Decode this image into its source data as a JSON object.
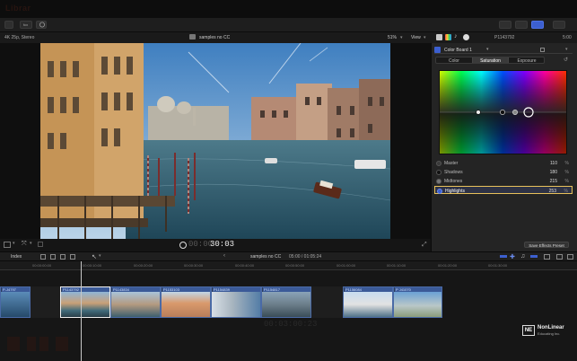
{
  "app": {
    "title_ghost": "Librar",
    "toolbar": {
      "left_btn": "fcx",
      "right_buttons": [
        "libraries-browser",
        "timeline",
        "inspector"
      ]
    }
  },
  "viewer": {
    "format": "4K 25p, Stereo",
    "clip_name": "samples no CC",
    "zoom": "51%",
    "view_menu": "View",
    "timecode": "00:00:30:03",
    "timecode_dim": "00:00",
    "timecode_bright": "30:03"
  },
  "inspector": {
    "clip_label": "P1143792",
    "duration": "5:00",
    "effect_name": "Color Board 1",
    "tabs": [
      "Color",
      "Saturation",
      "Exposure"
    ],
    "active_tab": "Saturation",
    "rows": [
      {
        "label": "Master",
        "value": "110",
        "unit": "%"
      },
      {
        "label": "Shadows",
        "value": "180",
        "unit": "%"
      },
      {
        "label": "Midtones",
        "value": "215",
        "unit": "%"
      },
      {
        "label": "Highlights",
        "value": "253",
        "unit": "%",
        "selected": true
      }
    ],
    "save_button": "Save Effects Preset"
  },
  "timeline": {
    "index_label": "Index",
    "project_name": "samples no CC",
    "project_duration": "05:00 / 01:05:24",
    "ruler_marks": [
      "00:00:00:00",
      "00:00:10:00",
      "00:00:20:00",
      "00:00:30:00",
      "00:00:40:00",
      "00:00:50:00",
      "00:01:00:00",
      "00:01:10:00",
      "00:01:20:00",
      "00:01:30:00"
    ],
    "clips": [
      {
        "name": "P-J4797"
      },
      {
        "name": "P1143792"
      },
      {
        "name": "P1143834"
      },
      {
        "name": "P1153103"
      },
      {
        "name": "P1154839"
      },
      {
        "name": "P1154817"
      },
      {
        "name": "P1156084"
      },
      {
        "name": "P J41070"
      }
    ],
    "watermark_tc": "00:03:00:23"
  },
  "branding": {
    "logo_mark": "NE",
    "logo_line1": "NonLinear",
    "logo_line2": "Educating Inc."
  },
  "colors": {
    "accent": "#3c5fcf",
    "selection_yellow": "#e8c15a",
    "clip_blue": "#3b5a98"
  }
}
